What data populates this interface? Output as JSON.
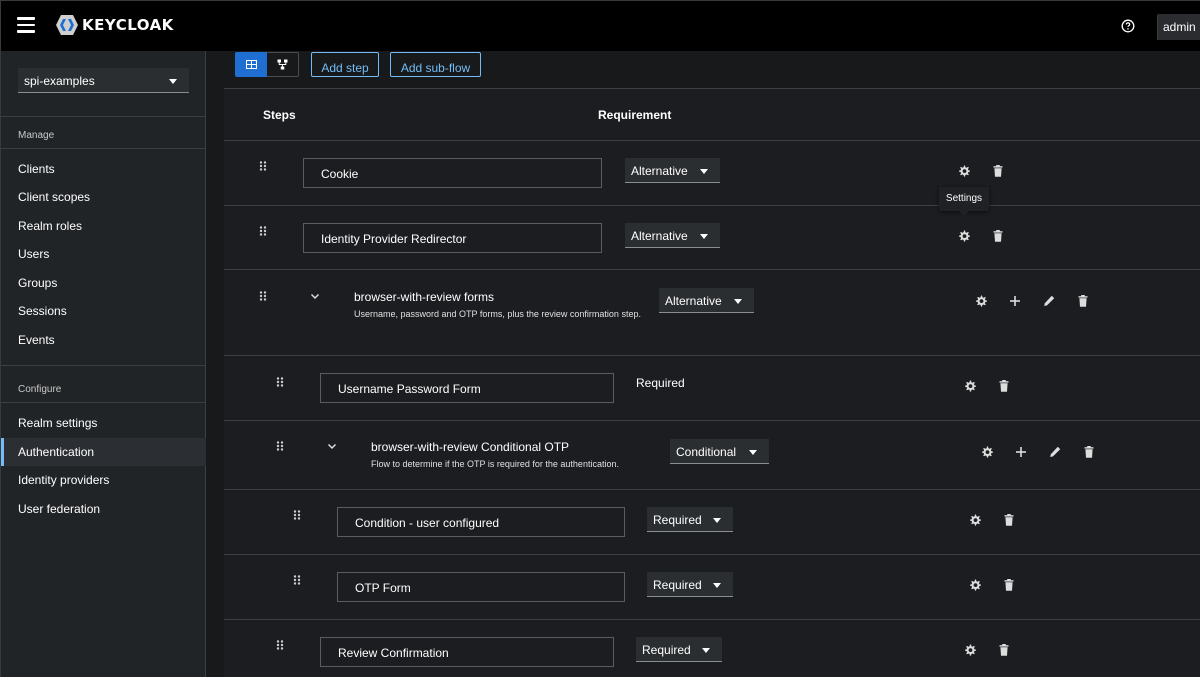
{
  "header": {
    "brand": "KEYCLOAK",
    "user_label": "admin",
    "help_icon": "help-circle-icon",
    "menu_icon": "hamburger-menu-icon"
  },
  "sidebar": {
    "realm": "spi-examples",
    "sections": {
      "manage": "Manage",
      "configure": "Configure"
    },
    "manage_items": [
      {
        "label": "Clients"
      },
      {
        "label": "Client scopes"
      },
      {
        "label": "Realm roles"
      },
      {
        "label": "Users"
      },
      {
        "label": "Groups"
      },
      {
        "label": "Sessions"
      },
      {
        "label": "Events"
      }
    ],
    "configure_items": [
      {
        "label": "Realm settings"
      },
      {
        "label": "Authentication"
      },
      {
        "label": "Identity providers"
      },
      {
        "label": "User federation"
      }
    ],
    "active_item": "Authentication"
  },
  "toolbar": {
    "add_step_label": "Add step",
    "add_subflow_label": "Add sub-flow",
    "view_table_icon": "table-view-icon",
    "view_diagram_icon": "diagram-view-icon"
  },
  "table": {
    "headers": {
      "steps": "Steps",
      "requirement": "Requirement"
    },
    "rows": [
      {
        "name": "Cookie",
        "requirement": "Alternative"
      },
      {
        "name": "Identity Provider Redirector",
        "requirement": "Alternative"
      },
      {
        "name": "browser-with-review forms",
        "description": "Username, password and OTP forms, plus the review confirmation step.",
        "requirement": "Alternative"
      },
      {
        "name": "Username Password Form",
        "requirement": "Required"
      },
      {
        "name": "browser-with-review Conditional OTP",
        "description": "Flow to determine if the OTP is required for the authentication.",
        "requirement": "Conditional"
      },
      {
        "name": "Condition - user configured",
        "requirement": "Required"
      },
      {
        "name": "OTP Form",
        "requirement": "Required"
      },
      {
        "name": "Review Confirmation",
        "requirement": "Required"
      }
    ]
  },
  "tooltip": {
    "label": "Settings"
  },
  "colors": {
    "accent": "#73bcf7",
    "primary": "#1f6fd2",
    "masthead": "#000000",
    "sidebar": "#212427"
  }
}
